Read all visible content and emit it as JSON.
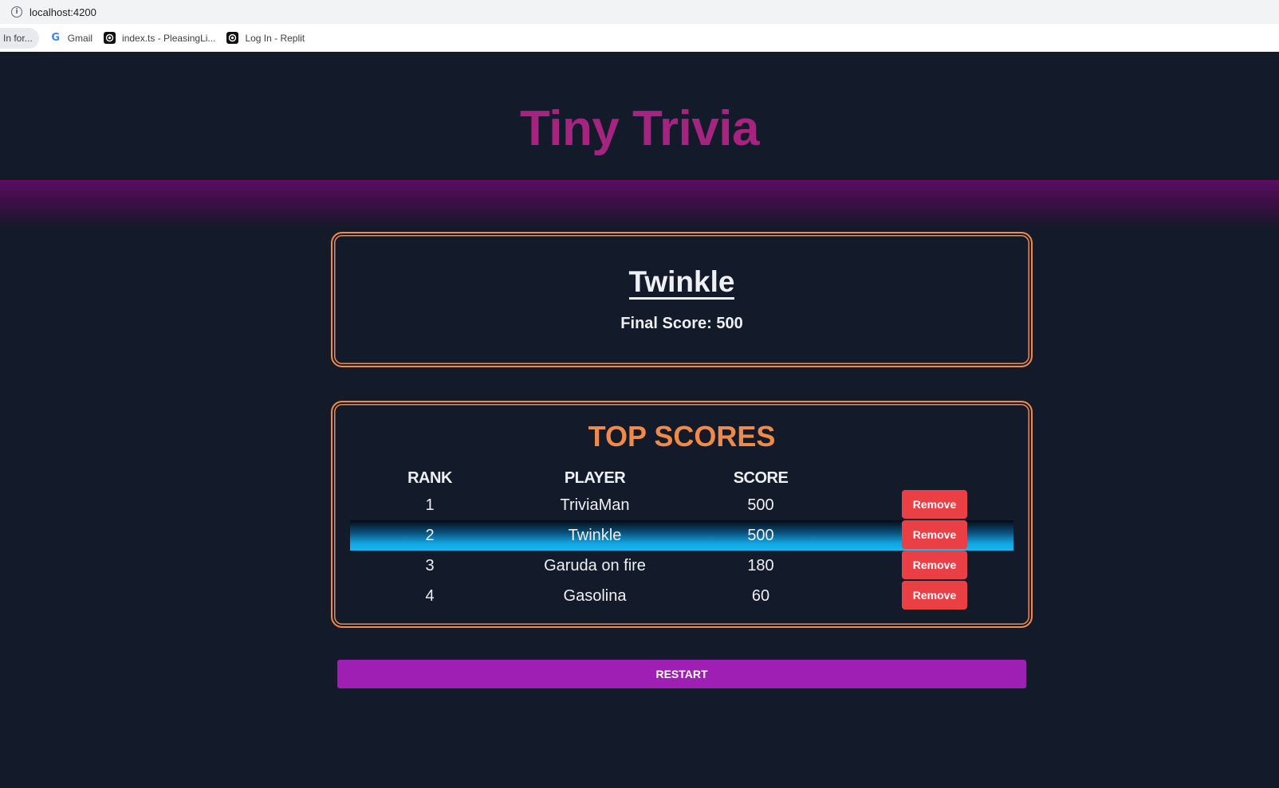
{
  "browser": {
    "url": "localhost:4200",
    "bookmarks": [
      {
        "label": "In for...",
        "icon": "none"
      },
      {
        "label": "Gmail",
        "icon": "google-icon"
      },
      {
        "label": "index.ts - PleasingLi...",
        "icon": "replit-icon"
      },
      {
        "label": "Log In - Replit",
        "icon": "replit-icon"
      }
    ]
  },
  "app": {
    "title": "Tiny Trivia"
  },
  "player": {
    "name": "Twinkle",
    "final_score_text": "Final Score: 500"
  },
  "scoreboard": {
    "title": "TOP SCORES",
    "headers": {
      "rank": "RANK",
      "player": "PLAYER",
      "score": "SCORE"
    },
    "rows": [
      {
        "rank": "1",
        "player": "TriviaMan",
        "score": "500",
        "remove": "Remove"
      },
      {
        "rank": "2",
        "player": "Twinkle",
        "score": "500",
        "remove": "Remove",
        "highlighted": true
      },
      {
        "rank": "3",
        "player": "Garuda on fire",
        "score": "180",
        "remove": "Remove"
      },
      {
        "rank": "4",
        "player": "Gasolina",
        "score": "60",
        "remove": "Remove"
      }
    ]
  },
  "actions": {
    "restart_label": "RESTART"
  },
  "colors": {
    "background": "#131a29",
    "title": "#a4247f",
    "accent_orange": "#f08a4b",
    "remove_red": "#ea3f45",
    "restart_purple": "#9f1eb3",
    "highlight_blue": "#11a3df"
  }
}
